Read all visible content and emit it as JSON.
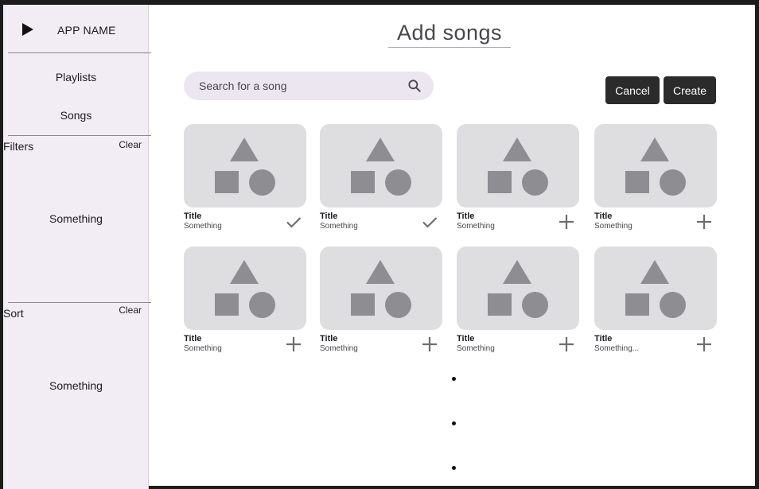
{
  "app": {
    "name": "APP NAME"
  },
  "sidebar": {
    "nav": [
      {
        "label": "Playlists"
      },
      {
        "label": "Songs"
      }
    ],
    "filters": {
      "title": "Filters",
      "clear_label": "Clear",
      "body": "Something"
    },
    "sort": {
      "title": "Sort",
      "clear_label": "Clear",
      "body": "Something"
    }
  },
  "main": {
    "title": "Add songs",
    "search": {
      "placeholder": "Search for a song",
      "icon": "search-icon"
    },
    "actions": {
      "cancel_label": "Cancel",
      "create_label": "Create"
    },
    "songs": [
      {
        "title": "Title",
        "subtitle": "Something",
        "state": "added"
      },
      {
        "title": "Title",
        "subtitle": "Something",
        "state": "added"
      },
      {
        "title": "Title",
        "subtitle": "Something",
        "state": "add"
      },
      {
        "title": "Title",
        "subtitle": "Something",
        "state": "add"
      },
      {
        "title": "Title",
        "subtitle": "Something",
        "state": "add"
      },
      {
        "title": "Title",
        "subtitle": "Something",
        "state": "add"
      },
      {
        "title": "Title",
        "subtitle": "Something",
        "state": "add"
      },
      {
        "title": "Title",
        "subtitle": "Something...",
        "state": "add"
      }
    ]
  },
  "colors": {
    "sidebar_bg": "#f2ecf5",
    "search_bg": "#ece6f0",
    "button_bg": "#2b2b2b",
    "thumb_bg": "#dedde0",
    "thumb_shape": "#8e8d91"
  }
}
